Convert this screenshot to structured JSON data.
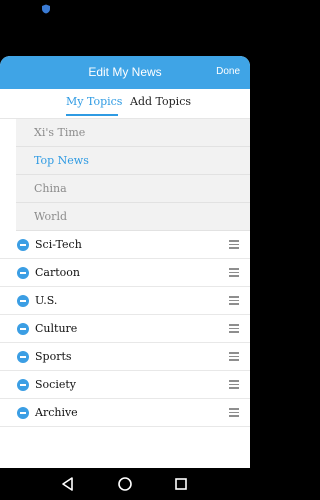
{
  "header": {
    "title": "Edit My News",
    "done_label": "Done",
    "accent_color": "#3fa4e6"
  },
  "tabs": [
    {
      "label": "My Topics",
      "active": true
    },
    {
      "label": "Add Topics",
      "active": false
    }
  ],
  "inactive_topics": [
    {
      "label": "Xi's Time",
      "selected": false
    },
    {
      "label": "Top News",
      "selected": true
    },
    {
      "label": "China",
      "selected": false
    },
    {
      "label": "World",
      "selected": false
    }
  ],
  "my_topics": [
    {
      "label": "Sci-Tech"
    },
    {
      "label": "Cartoon"
    },
    {
      "label": "U.S."
    },
    {
      "label": "Culture"
    },
    {
      "label": "Sports"
    },
    {
      "label": "Society"
    },
    {
      "label": "Archive"
    }
  ],
  "icons": {
    "status": "shield-icon",
    "remove": "minus-circle-icon",
    "drag": "drag-handle-icon",
    "nav": [
      "back-triangle-icon",
      "home-circle-icon",
      "recents-square-icon"
    ]
  }
}
